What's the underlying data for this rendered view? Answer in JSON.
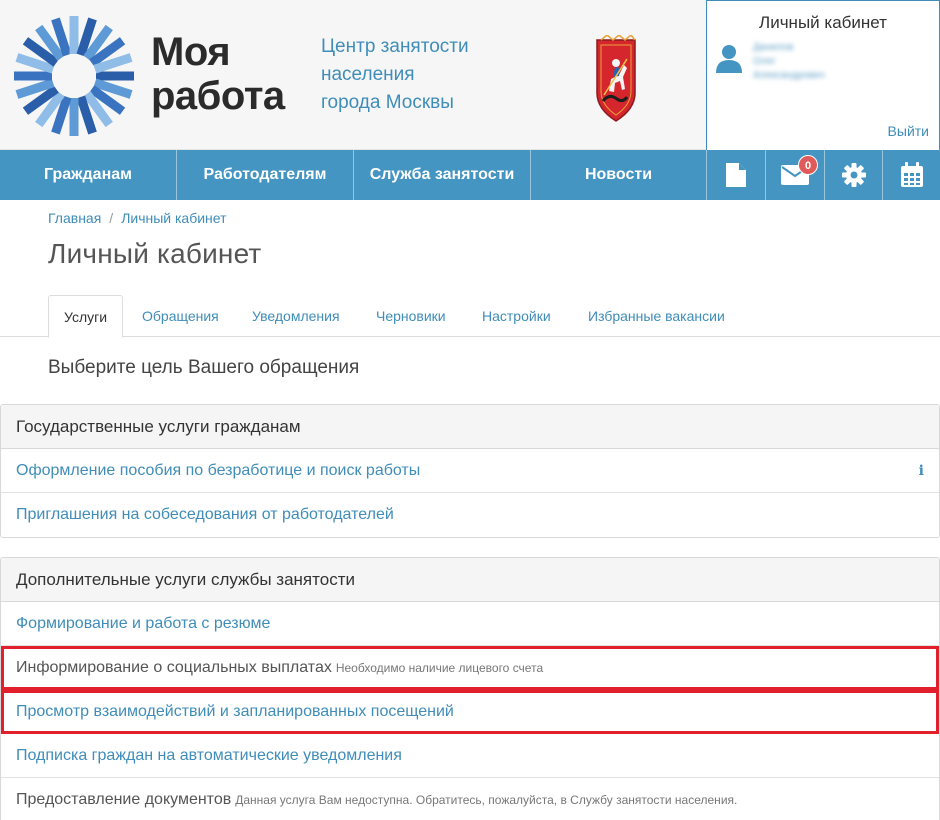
{
  "header": {
    "logo_line1": "Моя",
    "logo_line2": "работа",
    "center_line1": "Центр занятости",
    "center_line2": "населения",
    "center_line3": "города Москвы",
    "coat_icon": "moscow-coat-of-arms-icon"
  },
  "account": {
    "title": "Личный кабинет",
    "name_line1": "Данилов",
    "name_line2": "Олег",
    "name_line3": "Александрович",
    "logout_label": "Выйти"
  },
  "nav": {
    "items": [
      {
        "label": "Гражданам"
      },
      {
        "label": "Работодателям"
      },
      {
        "label": "Служба занятости"
      },
      {
        "label": "Новости"
      }
    ],
    "icons": [
      "document-icon",
      "envelope-icon",
      "gear-icon",
      "calendar-icon"
    ],
    "messages_count": "0"
  },
  "breadcrumb": {
    "home": "Главная",
    "separator": "/",
    "current": "Личный кабинет"
  },
  "page_title": "Личный кабинет",
  "tabs": [
    {
      "label": "Услуги",
      "active": true
    },
    {
      "label": "Обращения"
    },
    {
      "label": "Уведомления"
    },
    {
      "label": "Черновики"
    },
    {
      "label": "Настройки"
    },
    {
      "label": "Избранные вакансии"
    }
  ],
  "subtitle": "Выберите цель Вашего обращения",
  "panels": [
    {
      "heading": "Государственные услуги гражданам",
      "rows": [
        {
          "label": "Оформление пособия по безработице и поиск работы",
          "info_icon": "i"
        },
        {
          "label": "Приглашения на собеседования от работодателей"
        }
      ]
    },
    {
      "heading": "Дополнительные услуги службы занятости",
      "rows": [
        {
          "label": "Формирование и работа с резюме"
        },
        {
          "label": "Информирование о социальных выплатах",
          "note": "Необходимо наличие лицевого счета",
          "disabled": true,
          "highlighted": true
        },
        {
          "label": "Просмотр взаимодействий и запланированных посещений",
          "highlighted": true
        },
        {
          "label": "Подписка граждан на автоматические уведомления"
        },
        {
          "label": "Предоставление документов",
          "note": "Данная услуга Вам недоступна. Обратитесь, пожалуйста, в Службу занятости населения.",
          "disabled": true
        }
      ]
    }
  ],
  "colors": {
    "brand_blue": "#4595c2",
    "link_blue": "#3f8db8",
    "highlight_red": "#e2202c",
    "badge_red": "#e05a5a"
  }
}
